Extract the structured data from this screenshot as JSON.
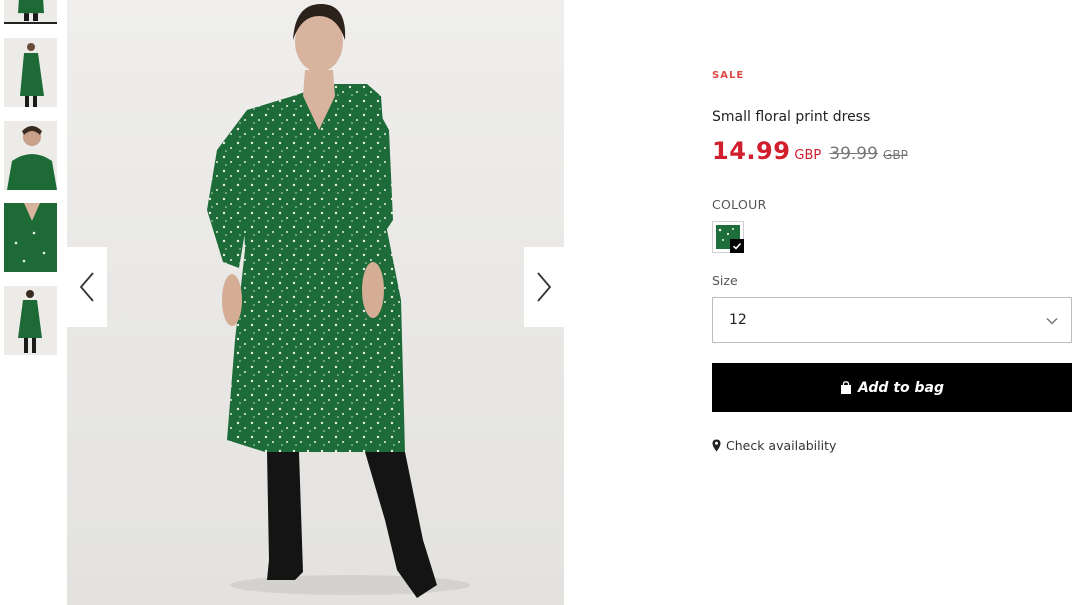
{
  "gallery": {
    "thumbnails": [
      {
        "alt": "front-full-view",
        "active": true
      },
      {
        "alt": "side-view"
      },
      {
        "alt": "close-up-view"
      },
      {
        "alt": "detail-view"
      },
      {
        "alt": "back-view"
      }
    ],
    "prev_icon": "chevron-left-icon",
    "next_icon": "chevron-right-icon"
  },
  "product": {
    "badge": "SALE",
    "name": "Small floral print dress",
    "price_now": "14.99",
    "currency_now": "GBP",
    "price_old": "39.99",
    "currency_old": "GBP"
  },
  "colour": {
    "label": "COLOUR",
    "swatches": [
      {
        "color": "#1d6e3a",
        "selected": true
      }
    ]
  },
  "size": {
    "label": "Size",
    "selected": "12"
  },
  "actions": {
    "add_to_bag": "Add to bag",
    "check_availability": "Check availability"
  },
  "colors": {
    "sale": "#e04848",
    "price": "#d21f2d",
    "button_bg": "#000000"
  }
}
